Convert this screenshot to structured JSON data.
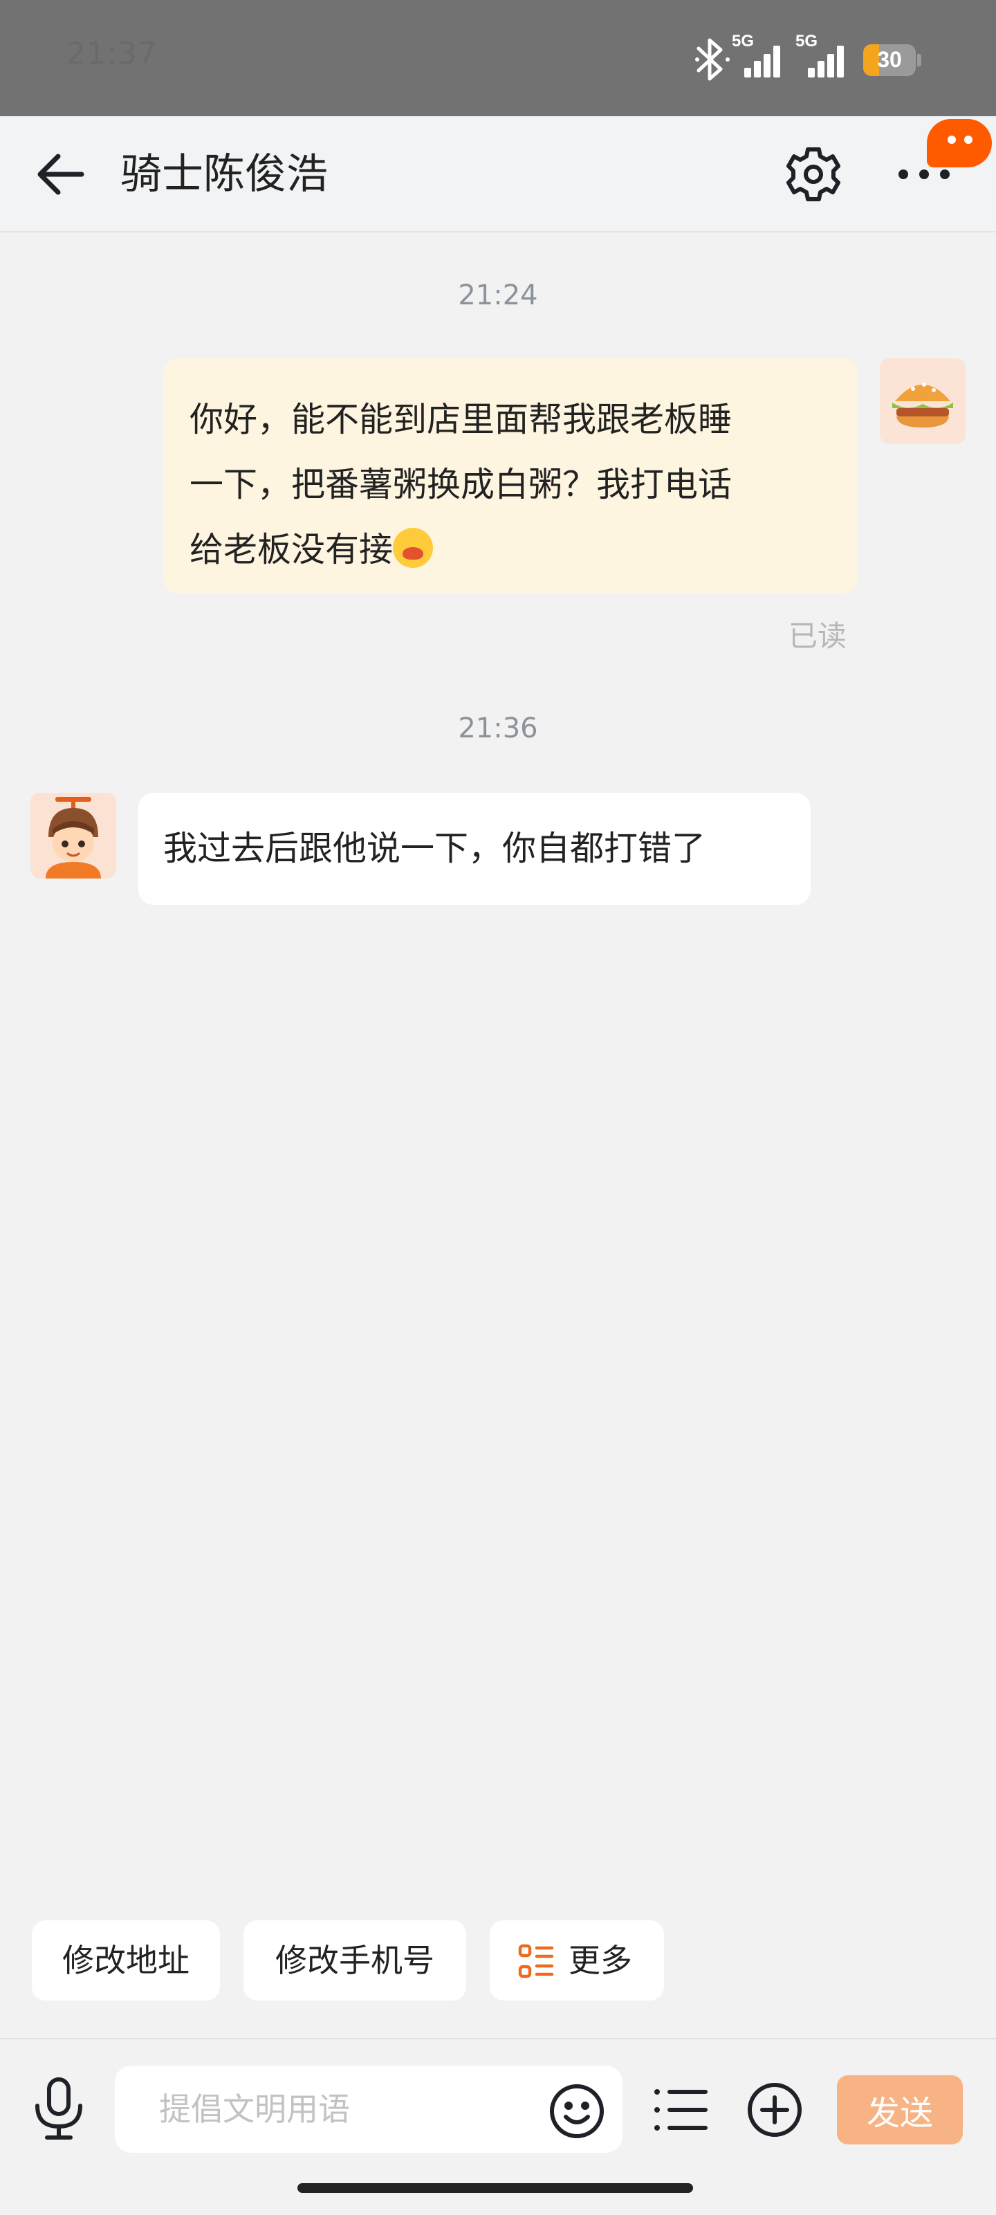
{
  "status_bar": {
    "time": "21:37",
    "signal_1_label": "5G",
    "signal_2_label": "5G",
    "battery_level": "30",
    "battery_fraction": 0.3,
    "battery_color": "#f5a41e"
  },
  "header": {
    "title": "骑士陈俊浩",
    "back_icon": "arrow-left-icon",
    "settings_icon": "gear-icon",
    "more_icon": "more-dots-icon"
  },
  "messages": [
    {
      "timestamp": "21:24",
      "direction": "outgoing",
      "lines": [
        "你好，能不能到店里面帮我跟老板睡",
        "一下，把番薯粥换成白粥？我打电话",
        "给老板没有接"
      ],
      "emoji": "crying-face-emoji",
      "status": "已读",
      "bubble_color": "#fef5e1"
    },
    {
      "timestamp": "21:36",
      "direction": "incoming",
      "text": "我过去后跟他说一下，你自都打错了",
      "bubble_color": "#ffffff"
    }
  ],
  "quick_actions": [
    {
      "label": "修改地址"
    },
    {
      "label": "修改手机号"
    },
    {
      "label": "更多",
      "icon": "menu-list-icon"
    }
  ],
  "input_bar": {
    "placeholder": "提倡文明用语",
    "send_label": "发送",
    "send_color": "#f8b385"
  },
  "accent_color": "#ff5a00"
}
